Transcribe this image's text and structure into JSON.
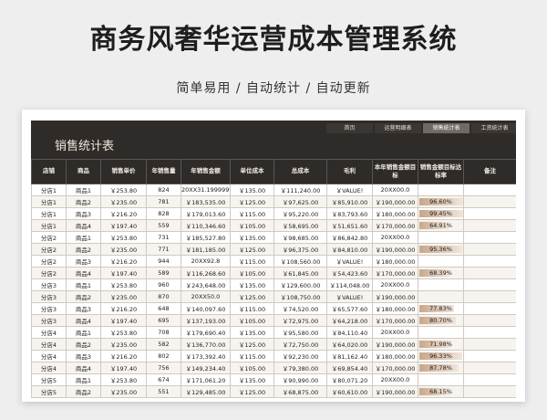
{
  "page": {
    "title": "商务风奢华运营成本管理系统",
    "subtitle": "简单易用 / 自动统计 / 自动更新"
  },
  "sheet": {
    "nav": [
      "首页",
      "运营明细表",
      "销售统计表",
      "工资统计表"
    ],
    "active_tab": 2,
    "title": "销售统计表",
    "columns": [
      "店铺",
      "商品",
      "销售单价",
      "年销售量",
      "年销售金额",
      "单位成本",
      "总成本",
      "毛利",
      "本年销售金额目标",
      "销售金额目标达标率",
      "备注"
    ],
    "rows": [
      {
        "store": "分店1",
        "product": "商品1",
        "price": "￥253.80",
        "qty": "824",
        "amount": "20XX31.1999999999",
        "unit_cost": "￥135.00",
        "total_cost": "￥111,240.00",
        "profit": "￥VALUE!",
        "target": "20XX00.0",
        "rate": "",
        "rate_value": null,
        "note": ""
      },
      {
        "store": "分店1",
        "product": "商品2",
        "price": "￥235.00",
        "qty": "781",
        "amount": "￥183,535.00",
        "unit_cost": "￥125.00",
        "total_cost": "￥97,625.00",
        "profit": "￥85,910.00",
        "target": "￥190,000.00",
        "rate": "96.60%",
        "rate_value": 0.966,
        "note": ""
      },
      {
        "store": "分店1",
        "product": "商品3",
        "price": "￥216.20",
        "qty": "828",
        "amount": "￥179,013.60",
        "unit_cost": "￥115.00",
        "total_cost": "￥95,220.00",
        "profit": "￥83,793.60",
        "target": "￥180,000.00",
        "rate": "99.45%",
        "rate_value": 0.9945,
        "note": ""
      },
      {
        "store": "分店1",
        "product": "商品4",
        "price": "￥197.40",
        "qty": "559",
        "amount": "￥110,346.60",
        "unit_cost": "￥105.00",
        "total_cost": "￥58,695.00",
        "profit": "￥51,651.60",
        "target": "￥170,000.00",
        "rate": "64.91%",
        "rate_value": 0.6491,
        "note": ""
      },
      {
        "store": "分店2",
        "product": "商品1",
        "price": "￥253.80",
        "qty": "731",
        "amount": "￥185,527.80",
        "unit_cost": "￥135.00",
        "total_cost": "￥98,685.00",
        "profit": "￥86,842.80",
        "target": "20XX00.0",
        "rate": "",
        "rate_value": null,
        "note": ""
      },
      {
        "store": "分店2",
        "product": "商品2",
        "price": "￥235.00",
        "qty": "771",
        "amount": "￥181,185.00",
        "unit_cost": "￥125.00",
        "total_cost": "￥96,375.00",
        "profit": "￥84,810.00",
        "target": "￥190,000.00",
        "rate": "95.36%",
        "rate_value": 0.9536,
        "note": ""
      },
      {
        "store": "分店2",
        "product": "商品3",
        "price": "￥216.20",
        "qty": "944",
        "amount": "20XX92.8",
        "unit_cost": "￥115.00",
        "total_cost": "￥108,560.00",
        "profit": "￥VALUE!",
        "target": "￥180,000.00",
        "rate": "",
        "rate_value": null,
        "note": ""
      },
      {
        "store": "分店2",
        "product": "商品4",
        "price": "￥197.40",
        "qty": "589",
        "amount": "￥116,268.60",
        "unit_cost": "￥105.00",
        "total_cost": "￥61,845.00",
        "profit": "￥54,423.60",
        "target": "￥170,000.00",
        "rate": "68.39%",
        "rate_value": 0.6839,
        "note": ""
      },
      {
        "store": "分店3",
        "product": "商品1",
        "price": "￥253.80",
        "qty": "960",
        "amount": "￥243,648.00",
        "unit_cost": "￥135.00",
        "total_cost": "￥129,600.00",
        "profit": "￥114,048.00",
        "target": "20XX00.0",
        "rate": "",
        "rate_value": null,
        "note": ""
      },
      {
        "store": "分店3",
        "product": "商品2",
        "price": "￥235.00",
        "qty": "870",
        "amount": "20XX50.0",
        "unit_cost": "￥125.00",
        "total_cost": "￥108,750.00",
        "profit": "￥VALUE!",
        "target": "￥190,000.00",
        "rate": "",
        "rate_value": null,
        "note": ""
      },
      {
        "store": "分店3",
        "product": "商品3",
        "price": "￥216.20",
        "qty": "648",
        "amount": "￥140,097.60",
        "unit_cost": "￥115.00",
        "total_cost": "￥74,520.00",
        "profit": "￥65,577.60",
        "target": "￥180,000.00",
        "rate": "77.83%",
        "rate_value": 0.7783,
        "note": ""
      },
      {
        "store": "分店3",
        "product": "商品4",
        "price": "￥197.40",
        "qty": "695",
        "amount": "￥137,193.00",
        "unit_cost": "￥105.00",
        "total_cost": "￥72,975.00",
        "profit": "￥64,218.00",
        "target": "￥170,000.00",
        "rate": "80.70%",
        "rate_value": 0.807,
        "note": ""
      },
      {
        "store": "分店4",
        "product": "商品1",
        "price": "￥253.80",
        "qty": "708",
        "amount": "￥179,690.40",
        "unit_cost": "￥135.00",
        "total_cost": "￥95,580.00",
        "profit": "￥84,110.40",
        "target": "20XX00.0",
        "rate": "",
        "rate_value": null,
        "note": ""
      },
      {
        "store": "分店4",
        "product": "商品2",
        "price": "￥235.00",
        "qty": "582",
        "amount": "￥136,770.00",
        "unit_cost": "￥125.00",
        "total_cost": "￥72,750.00",
        "profit": "￥64,020.00",
        "target": "￥190,000.00",
        "rate": "71.98%",
        "rate_value": 0.7198,
        "note": ""
      },
      {
        "store": "分店4",
        "product": "商品3",
        "price": "￥216.20",
        "qty": "802",
        "amount": "￥173,392.40",
        "unit_cost": "￥115.00",
        "total_cost": "￥92,230.00",
        "profit": "￥81,162.40",
        "target": "￥180,000.00",
        "rate": "96.33%",
        "rate_value": 0.9633,
        "note": ""
      },
      {
        "store": "分店4",
        "product": "商品4",
        "price": "￥197.40",
        "qty": "756",
        "amount": "￥149,234.40",
        "unit_cost": "￥105.00",
        "total_cost": "￥79,380.00",
        "profit": "￥69,854.40",
        "target": "￥170,000.00",
        "rate": "87.78%",
        "rate_value": 0.8778,
        "note": ""
      },
      {
        "store": "分店5",
        "product": "商品1",
        "price": "￥253.80",
        "qty": "674",
        "amount": "￥171,061.20",
        "unit_cost": "￥135.00",
        "total_cost": "￥90,990.00",
        "profit": "￥80,071.20",
        "target": "20XX00.0",
        "rate": "",
        "rate_value": null,
        "note": ""
      },
      {
        "store": "分店5",
        "product": "商品2",
        "price": "￥235.00",
        "qty": "551",
        "amount": "￥129,485.00",
        "unit_cost": "￥125.00",
        "total_cost": "￥68,875.00",
        "profit": "￥60,610.00",
        "target": "￥190,000.00",
        "rate": "68.15%",
        "rate_value": 0.6815,
        "note": ""
      }
    ]
  }
}
